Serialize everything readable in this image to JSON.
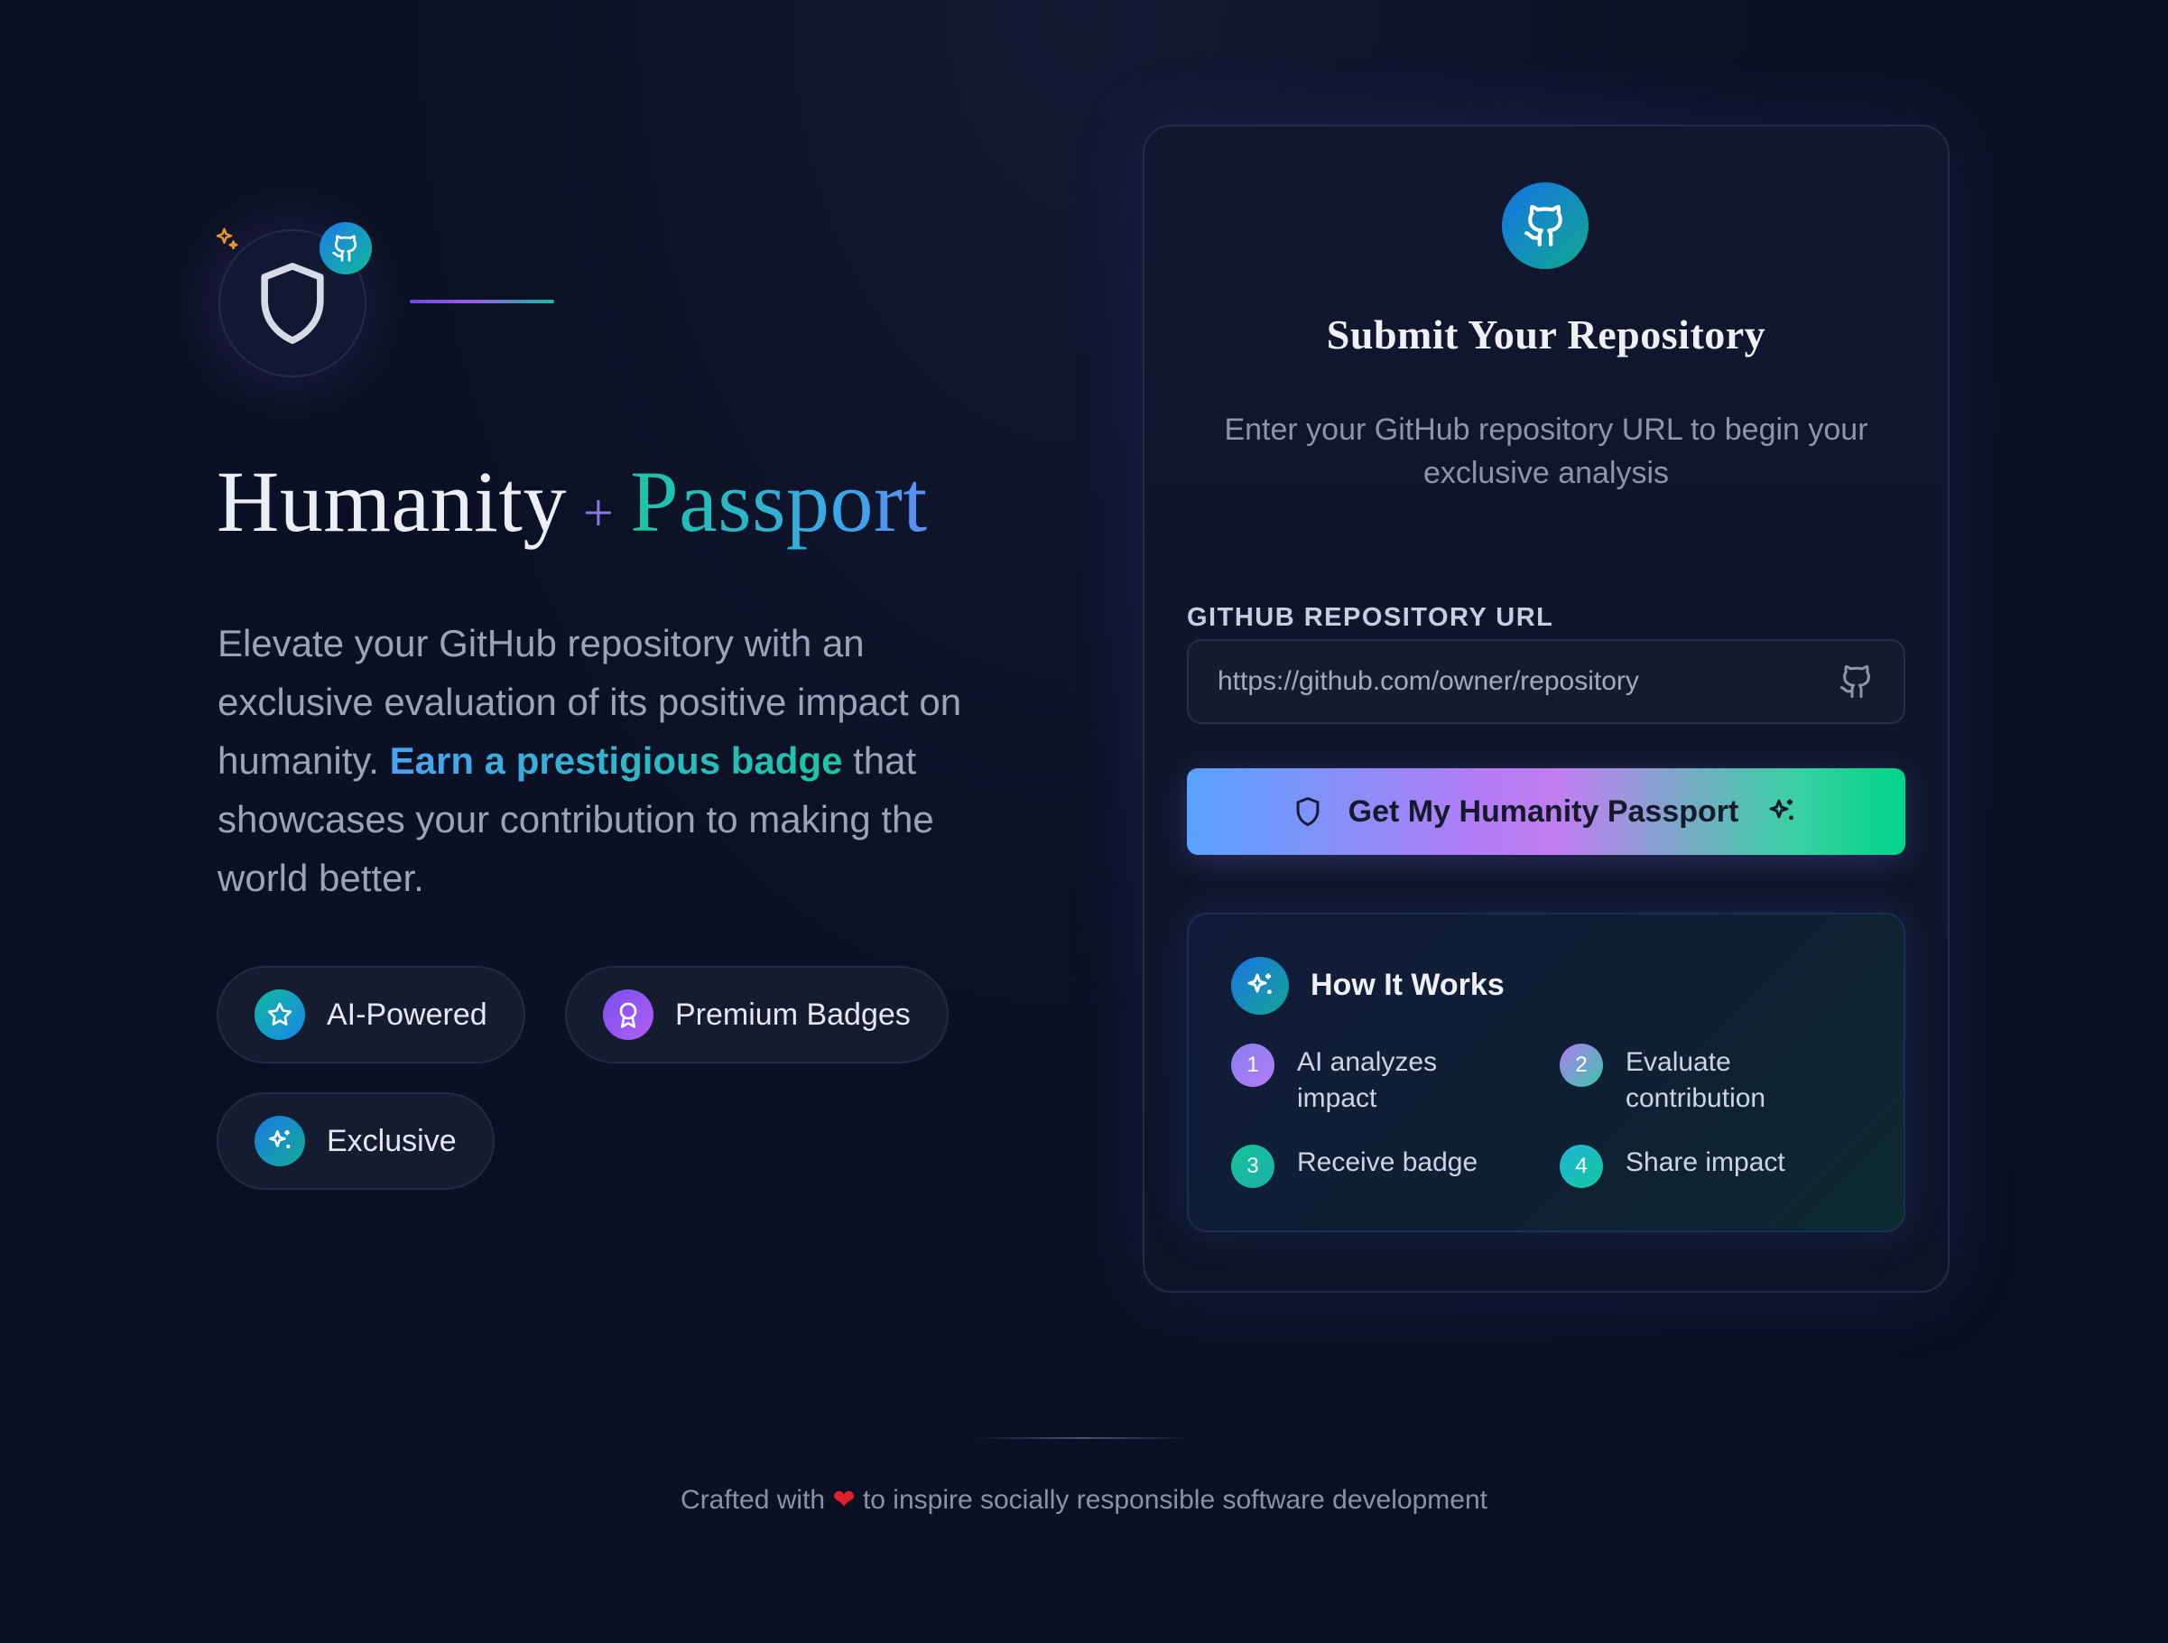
{
  "hero": {
    "title_part1": "Humanity",
    "title_plus": "+",
    "title_part2": "Passport",
    "desc_before": "Elevate your GitHub repository with an exclusive evaluation of its positive impact on humanity. ",
    "desc_highlight": "Earn a prestigious badge",
    "desc_after": " that showcases your contribution to making the world better."
  },
  "features": [
    {
      "label": "AI-Powered",
      "icon": "star-icon"
    },
    {
      "label": "Premium Badges",
      "icon": "award-icon"
    },
    {
      "label": "Exclusive",
      "icon": "sparkles-icon"
    }
  ],
  "form": {
    "title": "Submit Your Repository",
    "subtitle": "Enter your GitHub repository URL to begin your exclusive analysis",
    "field_label": "GITHUB REPOSITORY URL",
    "placeholder": "https://github.com/owner/repository",
    "value": "",
    "submit_label": "Get My Humanity Passport"
  },
  "how_it_works": {
    "title": "How It Works",
    "steps": [
      {
        "num": "1",
        "text": "AI analyzes impact"
      },
      {
        "num": "2",
        "text": "Evaluate contribution"
      },
      {
        "num": "3",
        "text": "Receive badge"
      },
      {
        "num": "4",
        "text": "Share impact"
      }
    ]
  },
  "footer": {
    "before": "Crafted with",
    "heart": "❤",
    "after": "to inspire socially responsible software development"
  },
  "colors": {
    "background": "#0b1124",
    "accent_teal": "#19c7a3",
    "accent_blue": "#4aa2f2",
    "accent_purple": "#b57cf5"
  }
}
